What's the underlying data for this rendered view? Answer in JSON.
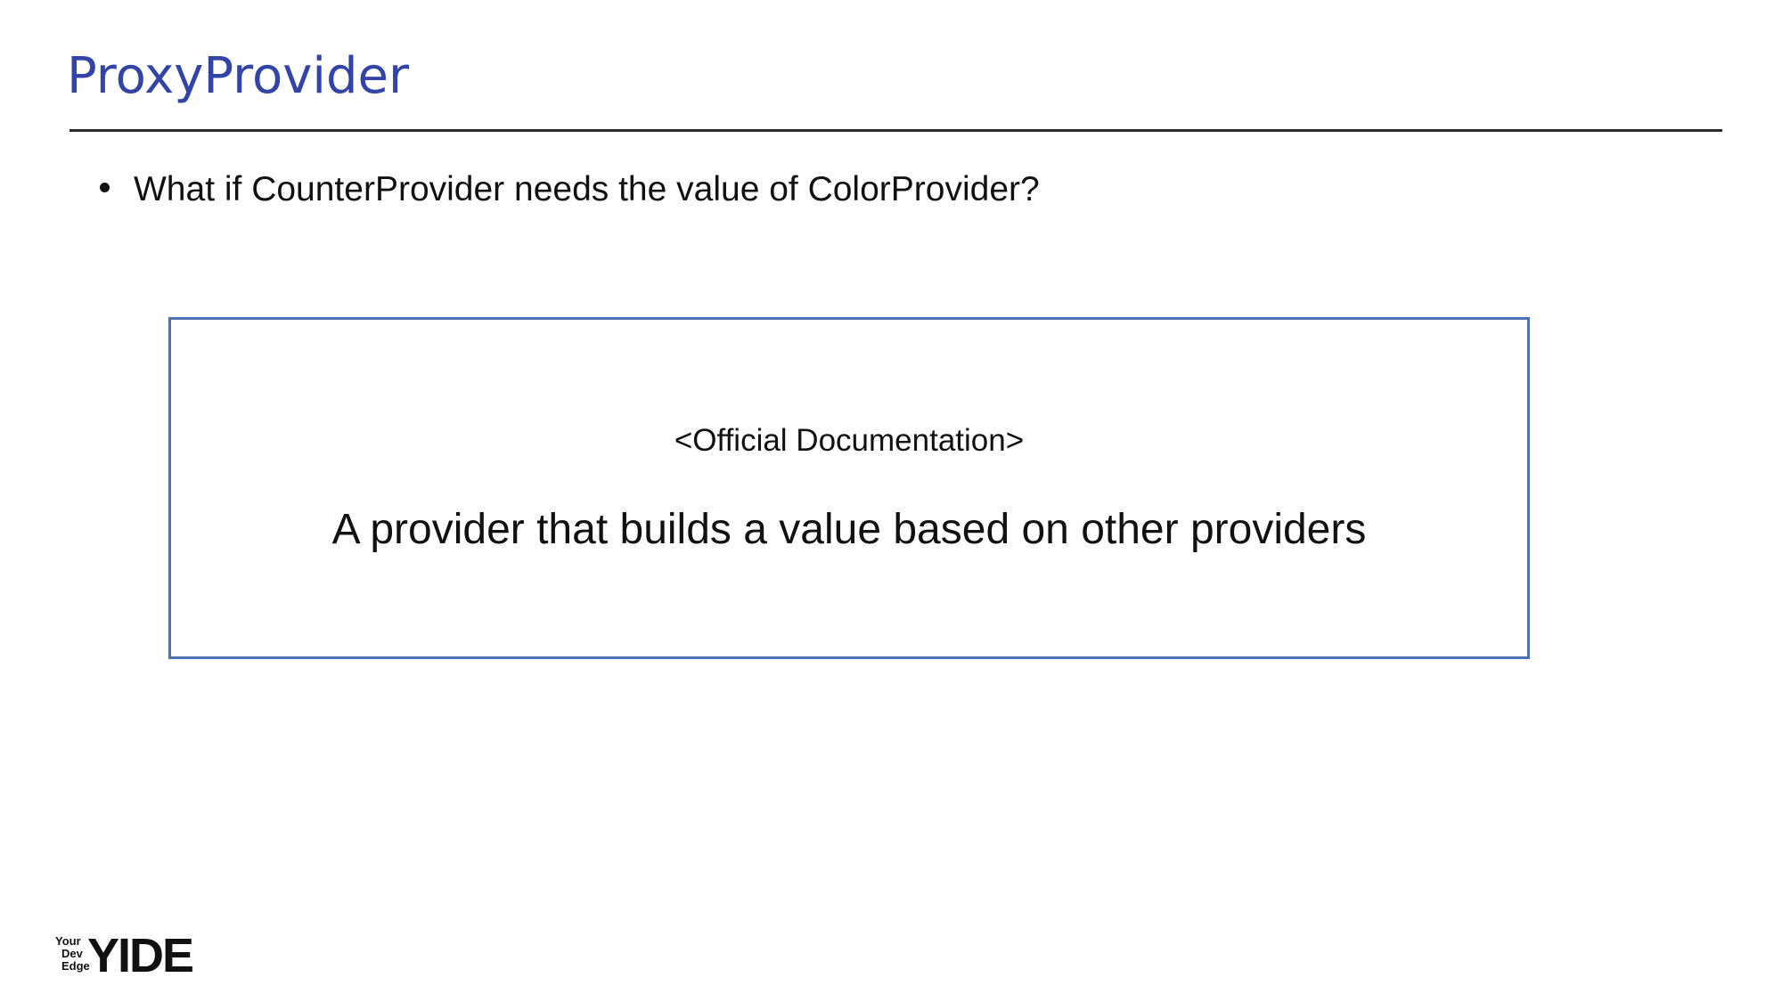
{
  "slide": {
    "title": "ProxyProvider",
    "bullets": [
      "What if CounterProvider needs the value of ColorProvider?"
    ],
    "box": {
      "label": "<Official Documentation>",
      "quote": "A provider that builds a value based on other providers"
    }
  },
  "logo": {
    "line1": "Your",
    "line2": "Dev",
    "line3": "Edge",
    "mark": "YIDE"
  },
  "colors": {
    "title": "#3344a8",
    "box_border": "#4a72b8",
    "text": "#111111"
  }
}
